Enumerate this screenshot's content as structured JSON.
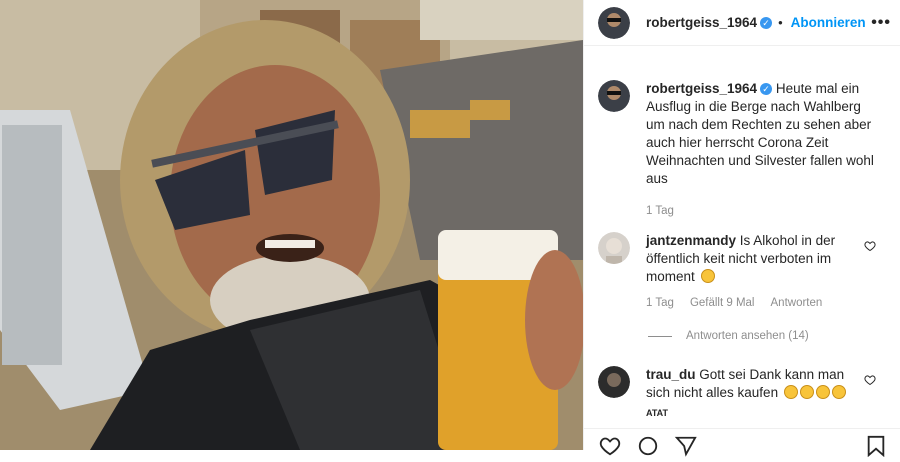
{
  "post": {
    "username": "robertgeiss_1964",
    "follow_label": "Abonnieren",
    "caption": "Heute mal ein Ausflug in die Berge nach Wahlberg um nach dem Rechten zu sehen aber auch hier herrscht Corona Zeit Weihnachten und Silvester fallen wohl aus",
    "caption_time": "1 Tag"
  },
  "comments": [
    {
      "username": "jantzenmandy",
      "text": "Is Alkohol in der öffentlich keit nicht verboten im moment",
      "emoji_count": 1,
      "time": "1 Tag",
      "likes": "Gefällt 9 Mal",
      "reply_label": "Antworten",
      "view_replies": "Antworten ansehen (14)"
    },
    {
      "username": "trau_du",
      "text": "Gott sei Dank kann man sich nicht alles kaufen",
      "emoji_count": 4,
      "extra": "ATAT"
    }
  ],
  "colors": {
    "accent": "#0095f6",
    "verified": "#3897f0",
    "muted": "#8e8e8e"
  },
  "icons": [
    "verified-badge-icon",
    "more-options-icon",
    "heart-icon",
    "comment-icon",
    "share-icon",
    "bookmark-icon"
  ]
}
